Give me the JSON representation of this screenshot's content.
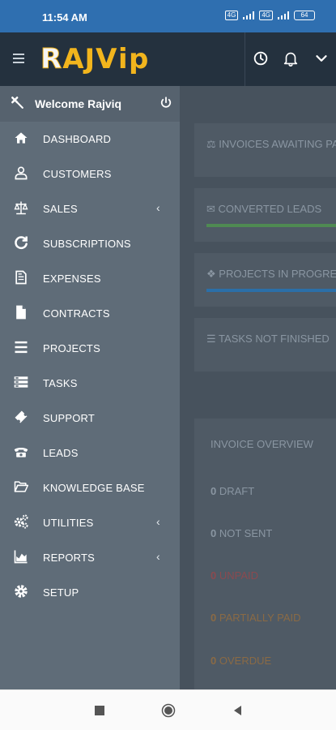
{
  "status_bar": {
    "time": "11:54 AM",
    "net1": "4G",
    "net2": "4G",
    "battery": "64"
  },
  "header": {
    "logo_text": "Rajviq"
  },
  "drawer": {
    "welcome": "Welcome Rajviq",
    "items": [
      {
        "label": "DASHBOARD",
        "icon": "home-icon",
        "submenu": false
      },
      {
        "label": "CUSTOMERS",
        "icon": "user-icon",
        "submenu": false
      },
      {
        "label": "SALES",
        "icon": "balance-scale-icon",
        "submenu": true
      },
      {
        "label": "SUBSCRIPTIONS",
        "icon": "refresh-icon",
        "submenu": false
      },
      {
        "label": "EXPENSES",
        "icon": "receipt-icon",
        "submenu": false
      },
      {
        "label": "CONTRACTS",
        "icon": "file-icon",
        "submenu": false
      },
      {
        "label": "PROJECTS",
        "icon": "bars-icon",
        "submenu": false
      },
      {
        "label": "TASKS",
        "icon": "tasks-icon",
        "submenu": false
      },
      {
        "label": "SUPPORT",
        "icon": "ticket-icon",
        "submenu": false
      },
      {
        "label": "LEADS",
        "icon": "phone-icon",
        "submenu": false
      },
      {
        "label": "KNOWLEDGE BASE",
        "icon": "folder-open-icon",
        "submenu": false
      },
      {
        "label": "UTILITIES",
        "icon": "cogs-icon",
        "submenu": true
      },
      {
        "label": "REPORTS",
        "icon": "area-chart-icon",
        "submenu": true
      },
      {
        "label": "SETUP",
        "icon": "gear-icon",
        "submenu": false
      }
    ]
  },
  "main": {
    "cards": [
      {
        "label": "INVOICES AWAITING PAYMENT",
        "icon": "balance-scale-icon",
        "bar_color": ""
      },
      {
        "label": "CONVERTED LEADS",
        "icon": "envelope-icon",
        "bar_color": "#4f8a52"
      },
      {
        "label": "PROJECTS IN PROGRESS",
        "icon": "cubes-icon",
        "bar_color": "#2b6fa8"
      },
      {
        "label": "TASKS NOT FINISHED",
        "icon": "list-icon",
        "bar_color": ""
      }
    ],
    "overview_title": "INVOICE OVERVIEW",
    "overview_rows": [
      {
        "num": "0",
        "label": "DRAFT",
        "color": "#8a96a2"
      },
      {
        "num": "0",
        "label": "NOT SENT",
        "color": "#8a96a2"
      },
      {
        "num": "0",
        "label": "UNPAID",
        "color": "#8b4a4f"
      },
      {
        "num": "0",
        "label": "PARTIALLY PAID",
        "color": "#8a6a45"
      },
      {
        "num": "0",
        "label": "OVERDUE",
        "color": "#8a6a45"
      }
    ]
  }
}
